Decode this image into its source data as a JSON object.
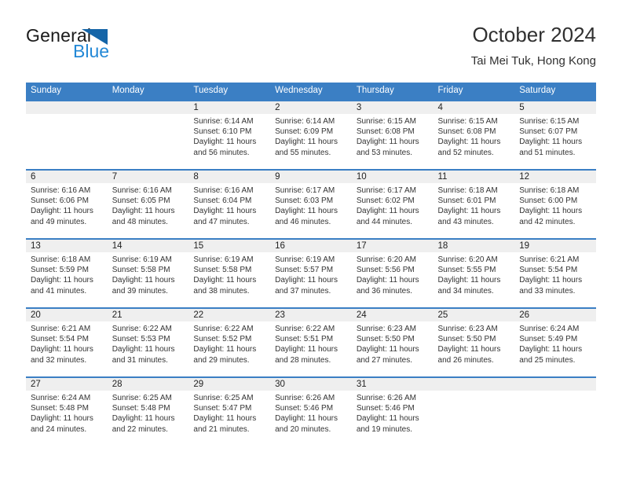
{
  "brand": {
    "name_part1": "General",
    "name_part2": "Blue",
    "logo_icon": "triangle-icon"
  },
  "header": {
    "title": "October 2024",
    "subtitle": "Tai Mei Tuk, Hong Kong"
  },
  "colors": {
    "header_blue": "#3b7fc4",
    "brand_dark_blue": "#1565a8",
    "brand_light_blue": "#2388d6",
    "daynum_band": "#efefef",
    "text": "#333333"
  },
  "weekday_headers": [
    "Sunday",
    "Monday",
    "Tuesday",
    "Wednesday",
    "Thursday",
    "Friday",
    "Saturday"
  ],
  "weeks": [
    [
      {
        "day": "",
        "empty": true,
        "sunrise": "",
        "sunset": "",
        "daylight_line1": "",
        "daylight_line2": ""
      },
      {
        "day": "",
        "empty": true,
        "sunrise": "",
        "sunset": "",
        "daylight_line1": "",
        "daylight_line2": ""
      },
      {
        "day": "1",
        "empty": false,
        "sunrise": "Sunrise: 6:14 AM",
        "sunset": "Sunset: 6:10 PM",
        "daylight_line1": "Daylight: 11 hours",
        "daylight_line2": "and 56 minutes."
      },
      {
        "day": "2",
        "empty": false,
        "sunrise": "Sunrise: 6:14 AM",
        "sunset": "Sunset: 6:09 PM",
        "daylight_line1": "Daylight: 11 hours",
        "daylight_line2": "and 55 minutes."
      },
      {
        "day": "3",
        "empty": false,
        "sunrise": "Sunrise: 6:15 AM",
        "sunset": "Sunset: 6:08 PM",
        "daylight_line1": "Daylight: 11 hours",
        "daylight_line2": "and 53 minutes."
      },
      {
        "day": "4",
        "empty": false,
        "sunrise": "Sunrise: 6:15 AM",
        "sunset": "Sunset: 6:08 PM",
        "daylight_line1": "Daylight: 11 hours",
        "daylight_line2": "and 52 minutes."
      },
      {
        "day": "5",
        "empty": false,
        "sunrise": "Sunrise: 6:15 AM",
        "sunset": "Sunset: 6:07 PM",
        "daylight_line1": "Daylight: 11 hours",
        "daylight_line2": "and 51 minutes."
      }
    ],
    [
      {
        "day": "6",
        "empty": false,
        "sunrise": "Sunrise: 6:16 AM",
        "sunset": "Sunset: 6:06 PM",
        "daylight_line1": "Daylight: 11 hours",
        "daylight_line2": "and 49 minutes."
      },
      {
        "day": "7",
        "empty": false,
        "sunrise": "Sunrise: 6:16 AM",
        "sunset": "Sunset: 6:05 PM",
        "daylight_line1": "Daylight: 11 hours",
        "daylight_line2": "and 48 minutes."
      },
      {
        "day": "8",
        "empty": false,
        "sunrise": "Sunrise: 6:16 AM",
        "sunset": "Sunset: 6:04 PM",
        "daylight_line1": "Daylight: 11 hours",
        "daylight_line2": "and 47 minutes."
      },
      {
        "day": "9",
        "empty": false,
        "sunrise": "Sunrise: 6:17 AM",
        "sunset": "Sunset: 6:03 PM",
        "daylight_line1": "Daylight: 11 hours",
        "daylight_line2": "and 46 minutes."
      },
      {
        "day": "10",
        "empty": false,
        "sunrise": "Sunrise: 6:17 AM",
        "sunset": "Sunset: 6:02 PM",
        "daylight_line1": "Daylight: 11 hours",
        "daylight_line2": "and 44 minutes."
      },
      {
        "day": "11",
        "empty": false,
        "sunrise": "Sunrise: 6:18 AM",
        "sunset": "Sunset: 6:01 PM",
        "daylight_line1": "Daylight: 11 hours",
        "daylight_line2": "and 43 minutes."
      },
      {
        "day": "12",
        "empty": false,
        "sunrise": "Sunrise: 6:18 AM",
        "sunset": "Sunset: 6:00 PM",
        "daylight_line1": "Daylight: 11 hours",
        "daylight_line2": "and 42 minutes."
      }
    ],
    [
      {
        "day": "13",
        "empty": false,
        "sunrise": "Sunrise: 6:18 AM",
        "sunset": "Sunset: 5:59 PM",
        "daylight_line1": "Daylight: 11 hours",
        "daylight_line2": "and 41 minutes."
      },
      {
        "day": "14",
        "empty": false,
        "sunrise": "Sunrise: 6:19 AM",
        "sunset": "Sunset: 5:58 PM",
        "daylight_line1": "Daylight: 11 hours",
        "daylight_line2": "and 39 minutes."
      },
      {
        "day": "15",
        "empty": false,
        "sunrise": "Sunrise: 6:19 AM",
        "sunset": "Sunset: 5:58 PM",
        "daylight_line1": "Daylight: 11 hours",
        "daylight_line2": "and 38 minutes."
      },
      {
        "day": "16",
        "empty": false,
        "sunrise": "Sunrise: 6:19 AM",
        "sunset": "Sunset: 5:57 PM",
        "daylight_line1": "Daylight: 11 hours",
        "daylight_line2": "and 37 minutes."
      },
      {
        "day": "17",
        "empty": false,
        "sunrise": "Sunrise: 6:20 AM",
        "sunset": "Sunset: 5:56 PM",
        "daylight_line1": "Daylight: 11 hours",
        "daylight_line2": "and 36 minutes."
      },
      {
        "day": "18",
        "empty": false,
        "sunrise": "Sunrise: 6:20 AM",
        "sunset": "Sunset: 5:55 PM",
        "daylight_line1": "Daylight: 11 hours",
        "daylight_line2": "and 34 minutes."
      },
      {
        "day": "19",
        "empty": false,
        "sunrise": "Sunrise: 6:21 AM",
        "sunset": "Sunset: 5:54 PM",
        "daylight_line1": "Daylight: 11 hours",
        "daylight_line2": "and 33 minutes."
      }
    ],
    [
      {
        "day": "20",
        "empty": false,
        "sunrise": "Sunrise: 6:21 AM",
        "sunset": "Sunset: 5:54 PM",
        "daylight_line1": "Daylight: 11 hours",
        "daylight_line2": "and 32 minutes."
      },
      {
        "day": "21",
        "empty": false,
        "sunrise": "Sunrise: 6:22 AM",
        "sunset": "Sunset: 5:53 PM",
        "daylight_line1": "Daylight: 11 hours",
        "daylight_line2": "and 31 minutes."
      },
      {
        "day": "22",
        "empty": false,
        "sunrise": "Sunrise: 6:22 AM",
        "sunset": "Sunset: 5:52 PM",
        "daylight_line1": "Daylight: 11 hours",
        "daylight_line2": "and 29 minutes."
      },
      {
        "day": "23",
        "empty": false,
        "sunrise": "Sunrise: 6:22 AM",
        "sunset": "Sunset: 5:51 PM",
        "daylight_line1": "Daylight: 11 hours",
        "daylight_line2": "and 28 minutes."
      },
      {
        "day": "24",
        "empty": false,
        "sunrise": "Sunrise: 6:23 AM",
        "sunset": "Sunset: 5:50 PM",
        "daylight_line1": "Daylight: 11 hours",
        "daylight_line2": "and 27 minutes."
      },
      {
        "day": "25",
        "empty": false,
        "sunrise": "Sunrise: 6:23 AM",
        "sunset": "Sunset: 5:50 PM",
        "daylight_line1": "Daylight: 11 hours",
        "daylight_line2": "and 26 minutes."
      },
      {
        "day": "26",
        "empty": false,
        "sunrise": "Sunrise: 6:24 AM",
        "sunset": "Sunset: 5:49 PM",
        "daylight_line1": "Daylight: 11 hours",
        "daylight_line2": "and 25 minutes."
      }
    ],
    [
      {
        "day": "27",
        "empty": false,
        "sunrise": "Sunrise: 6:24 AM",
        "sunset": "Sunset: 5:48 PM",
        "daylight_line1": "Daylight: 11 hours",
        "daylight_line2": "and 24 minutes."
      },
      {
        "day": "28",
        "empty": false,
        "sunrise": "Sunrise: 6:25 AM",
        "sunset": "Sunset: 5:48 PM",
        "daylight_line1": "Daylight: 11 hours",
        "daylight_line2": "and 22 minutes."
      },
      {
        "day": "29",
        "empty": false,
        "sunrise": "Sunrise: 6:25 AM",
        "sunset": "Sunset: 5:47 PM",
        "daylight_line1": "Daylight: 11 hours",
        "daylight_line2": "and 21 minutes."
      },
      {
        "day": "30",
        "empty": false,
        "sunrise": "Sunrise: 6:26 AM",
        "sunset": "Sunset: 5:46 PM",
        "daylight_line1": "Daylight: 11 hours",
        "daylight_line2": "and 20 minutes."
      },
      {
        "day": "31",
        "empty": false,
        "sunrise": "Sunrise: 6:26 AM",
        "sunset": "Sunset: 5:46 PM",
        "daylight_line1": "Daylight: 11 hours",
        "daylight_line2": "and 19 minutes."
      },
      {
        "day": "",
        "empty": true,
        "sunrise": "",
        "sunset": "",
        "daylight_line1": "",
        "daylight_line2": ""
      },
      {
        "day": "",
        "empty": true,
        "sunrise": "",
        "sunset": "",
        "daylight_line1": "",
        "daylight_line2": ""
      }
    ]
  ]
}
